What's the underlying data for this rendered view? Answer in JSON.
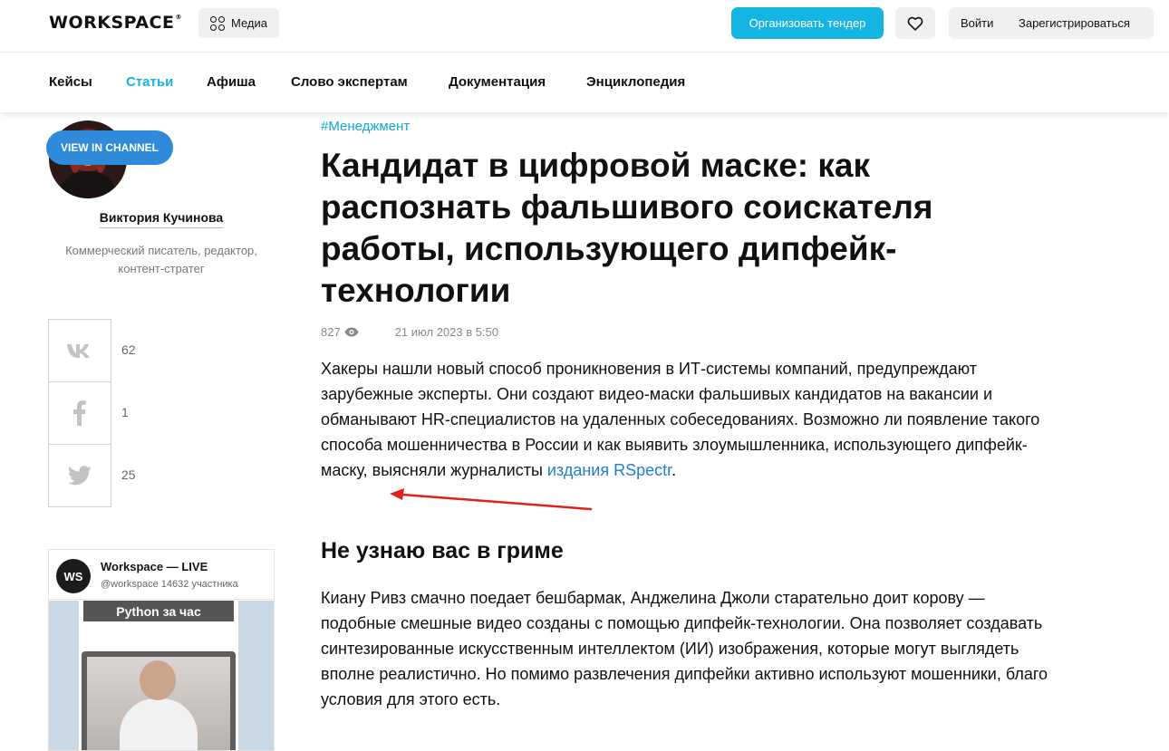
{
  "header": {
    "logo": "WORKSPACE",
    "logo_sup": "®",
    "media_label": "Медиа",
    "tender_label": "Организовать тендер",
    "login_label": "Войти",
    "register_label": "Зарегистрироваться"
  },
  "nav": {
    "items": [
      "Кейсы",
      "Статьи",
      "Афиша",
      "Слово экспертам",
      "Документация",
      "Энциклопедия"
    ],
    "active": "Статьи"
  },
  "author": {
    "name": "Виктория Кучинова",
    "description": "Коммерческий писатель, редактор, контент-стратег"
  },
  "shares": [
    {
      "network": "vk-icon",
      "count": "62"
    },
    {
      "network": "facebook-icon",
      "count": "1"
    },
    {
      "network": "twitter-icon",
      "count": "25"
    }
  ],
  "widget": {
    "logo": "WS",
    "title": "Workspace — LIVE",
    "subtitle": "@workspace 14632 участника",
    "card_title": "Python за час",
    "button": "VIEW IN CHANNEL"
  },
  "article": {
    "tag": "#Менеджмент",
    "title": "Кандидат в цифровой маске: как распознать фальшивого соискателя работы, использующего дипфейк-технологии",
    "views": "827",
    "date": "21 июл 2023 в 5:50",
    "intro_text": "Хакеры нашли новый способ проникновения в ИТ-системы компаний, предупреждают зарубежные эксперты. Они создают видео-маски фальшивых кандидатов на вакансии и обманывают HR-специалистов на удаленных собеседованиях. Возможно ли появление такого способа мошенничества в России и как выявить злоумышленника, использующего дипфейк-маску, выясняли журналисты ",
    "intro_link": "издания RSpectr",
    "intro_end": ".",
    "subheading": "Не узнаю вас в гриме",
    "body_text": "Киану Ривз смачно поедает бешбармак, Анджелина Джоли старательно доит корову — подобные смешные видео созданы с помощью дипфейк-технологии. Она позволяет создавать синтезированные искусственным интеллектом (ИИ) изображения, которые могут выглядеть вполне реалистично. Но помимо развлечения дипфейки активно используют мошенники, благо условия для этого есть."
  },
  "colors": {
    "accent": "#14b4e3",
    "link": "#1f7fd0",
    "arrow": "#e0201b"
  }
}
